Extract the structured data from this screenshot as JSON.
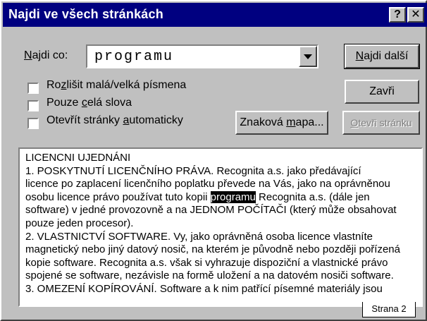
{
  "window": {
    "title": "Najdi ve všech stránkách",
    "help_label": "?",
    "close_label": "✕"
  },
  "search": {
    "label_pre": "",
    "label_mnemonic": "N",
    "label_post": "ajdi co:",
    "value": "programu"
  },
  "options": [
    {
      "pre": "Ro",
      "mnemonic": "z",
      "post": "lišit malá/velká písmena",
      "checked": false
    },
    {
      "pre": "Pouze ",
      "mnemonic": "c",
      "post": "elá slova",
      "checked": false
    },
    {
      "pre": "Otevřít stránky ",
      "mnemonic": "a",
      "post": "utomaticky",
      "checked": false
    }
  ],
  "buttons": {
    "find_next": {
      "pre": "",
      "mnemonic": "N",
      "post": "ajdi další"
    },
    "close": {
      "pre": "",
      "mnemonic": "",
      "post": "Zavři"
    },
    "char_map": {
      "pre": "Znaková ",
      "mnemonic": "m",
      "post": "apa..."
    },
    "open_page": {
      "pre": "",
      "mnemonic": "O",
      "post": "tevři stránku"
    }
  },
  "text": {
    "lines": [
      {
        "text": "LICENCNI UJEDNÁNI"
      },
      {
        "text": "1. POSKYTNUTÍ LICENČNÍHO PRÁVA. Recognita a.s. jako předávající"
      },
      {
        "text": "licence po zaplacení licenčního poplatku převede na Vás, jako na oprávněnou"
      },
      {
        "pre": "osobu licence právo používat tuto kopii ",
        "highlight": "programu",
        "post": " Recognita a.s. (dále jen"
      },
      {
        "text": "software) v jedné provozovně a na JEDNOM POČÍTAČI (který může obsahovat"
      },
      {
        "text": "pouze jeden procesor)."
      },
      {
        "text": "2. VLASTNICTVÍ SOFTWARE. Vy, jako oprávněná osoba licence vlastníte"
      },
      {
        "text": "magnetický nebo jiný datový nosič, na kterém je původně nebo později pořízená"
      },
      {
        "text": "kopie software. Recognita a.s. však si vyhrazuje dispoziční a vlastnické právo"
      },
      {
        "text": "spojené se software, nezávisle na formě uložení a na datovém nosiči software."
      },
      {
        "text": "3. OMEZENÍ KOPÍROVÁNÍ. Software a k nim patřící písemné materiály jsou"
      }
    ],
    "page_label": "Strana 2"
  }
}
